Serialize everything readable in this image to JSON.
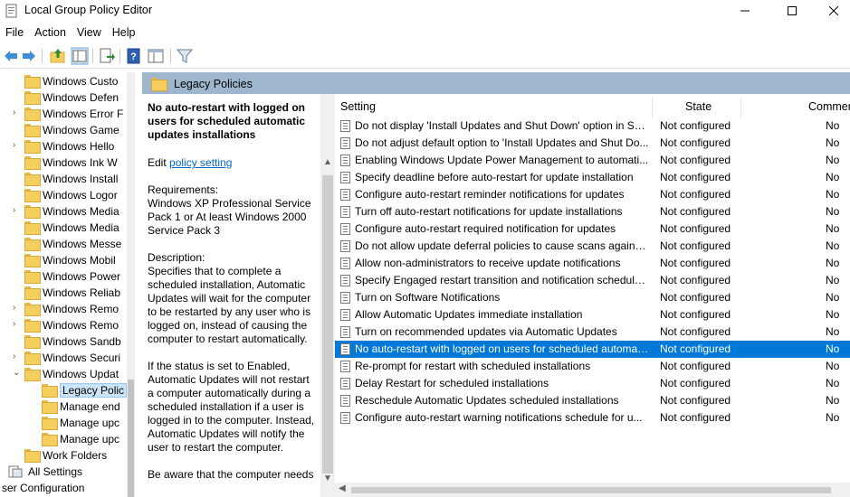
{
  "window": {
    "title": "Local Group Policy Editor",
    "icons": [
      "app-icon",
      "minimize-icon",
      "maximize-icon",
      "close-icon"
    ]
  },
  "menu": [
    "File",
    "Action",
    "View",
    "Help"
  ],
  "toolbar": {
    "icons": [
      "back-arrow-icon",
      "forward-arrow-icon",
      "up-folder-icon",
      "show-hide-tree-icon",
      "export-list-icon",
      "help-icon",
      "extended-view-icon",
      "filter-icon"
    ]
  },
  "tree": {
    "items": [
      {
        "label": "Windows Custo",
        "expander": ""
      },
      {
        "label": "Windows Defen",
        "expander": ""
      },
      {
        "label": "Windows Error F",
        "expander": "›"
      },
      {
        "label": "Windows Game",
        "expander": ""
      },
      {
        "label": "Windows Hello",
        "expander": "›"
      },
      {
        "label": "Windows Ink W",
        "expander": ""
      },
      {
        "label": "Windows Install",
        "expander": ""
      },
      {
        "label": "Windows Logor",
        "expander": ""
      },
      {
        "label": "Windows Media",
        "expander": "›"
      },
      {
        "label": "Windows Media",
        "expander": ""
      },
      {
        "label": "Windows Messe",
        "expander": ""
      },
      {
        "label": "Windows Mobil",
        "expander": ""
      },
      {
        "label": "Windows Power",
        "expander": ""
      },
      {
        "label": "Windows Reliab",
        "expander": ""
      },
      {
        "label": "Windows Remo",
        "expander": "›"
      },
      {
        "label": "Windows Remo",
        "expander": "›"
      },
      {
        "label": "Windows Sandb",
        "expander": ""
      },
      {
        "label": "Windows Securi",
        "expander": "›"
      },
      {
        "label": "Windows Updat",
        "expander": "⌄"
      },
      {
        "label": "Legacy Polic",
        "expander": "",
        "child": true,
        "selected": true
      },
      {
        "label": "Manage end",
        "expander": "",
        "child": true
      },
      {
        "label": "Manage upc",
        "expander": "",
        "child": true
      },
      {
        "label": "Manage upc",
        "expander": "",
        "child": true
      },
      {
        "label": "Work Folders",
        "expander": ""
      },
      {
        "label": "All Settings",
        "expander": "",
        "settings": true
      }
    ],
    "status": "ser Configuration"
  },
  "header": {
    "title": "Legacy Policies"
  },
  "description": {
    "title": "No auto-restart with logged on users for scheduled automatic updates installations",
    "edit_prefix": "Edit ",
    "edit_link": "policy setting",
    "requirements": "Requirements:\nWindows XP Professional Service Pack 1 or At least Windows 2000 Service Pack 3",
    "desc": "Description:\nSpecifies that to complete a scheduled installation, Automatic Updates will wait for the computer to be restarted by any user who is logged on, instead of causing the computer to restart automatically.",
    "status_text": "If the status is set to Enabled, Automatic Updates will not restart a computer automatically during a scheduled installation if a user is logged in to the computer. Instead, Automatic Updates will notify the user to restart the computer.",
    "more": "Be aware that the computer needs"
  },
  "list": {
    "columns": {
      "setting": "Setting",
      "state": "State",
      "comment": "Comment"
    },
    "rows": [
      {
        "setting": "Do not display 'Install Updates and Shut Down' option in Sh...",
        "state": "Not configured",
        "comment": "No"
      },
      {
        "setting": "Do not adjust default option to 'Install Updates and Shut Do...",
        "state": "Not configured",
        "comment": "No"
      },
      {
        "setting": "Enabling Windows Update Power Management to automati...",
        "state": "Not configured",
        "comment": "No"
      },
      {
        "setting": "Specify deadline before auto-restart for update installation",
        "state": "Not configured",
        "comment": "No"
      },
      {
        "setting": "Configure auto-restart reminder notifications for updates",
        "state": "Not configured",
        "comment": "No"
      },
      {
        "setting": "Turn off auto-restart notifications for update installations",
        "state": "Not configured",
        "comment": "No"
      },
      {
        "setting": "Configure auto-restart required notification for updates",
        "state": "Not configured",
        "comment": "No"
      },
      {
        "setting": "Do not allow update deferral policies to cause scans against ...",
        "state": "Not configured",
        "comment": "No"
      },
      {
        "setting": "Allow non-administrators to receive update notifications",
        "state": "Not configured",
        "comment": "No"
      },
      {
        "setting": "Specify Engaged restart transition and notification schedule ...",
        "state": "Not configured",
        "comment": "No"
      },
      {
        "setting": "Turn on Software Notifications",
        "state": "Not configured",
        "comment": "No"
      },
      {
        "setting": "Allow Automatic Updates immediate installation",
        "state": "Not configured",
        "comment": "No"
      },
      {
        "setting": "Turn on recommended updates via Automatic Updates",
        "state": "Not configured",
        "comment": "No"
      },
      {
        "setting": "No auto-restart with logged on users for scheduled automat...",
        "state": "Not configured",
        "comment": "No",
        "selected": true
      },
      {
        "setting": "Re-prompt for restart with scheduled installations",
        "state": "Not configured",
        "comment": "No"
      },
      {
        "setting": "Delay Restart for scheduled installations",
        "state": "Not configured",
        "comment": "No"
      },
      {
        "setting": "Reschedule Automatic Updates scheduled installations",
        "state": "Not configured",
        "comment": "No"
      },
      {
        "setting": "Configure auto-restart warning notifications schedule for u...",
        "state": "Not configured",
        "comment": "No"
      }
    ]
  }
}
